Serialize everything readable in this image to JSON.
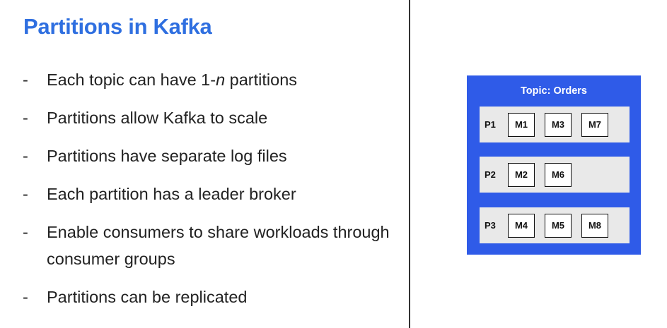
{
  "slide": {
    "title": "Partitions in Kafka",
    "bullets": [
      {
        "before": "Each topic can have 1-",
        "italic": "n",
        "after": " partitions"
      },
      {
        "text": "Partitions allow Kafka to scale"
      },
      {
        "text": "Partitions have separate log files"
      },
      {
        "text": "Each partition has a leader broker"
      },
      {
        "text": "Enable consumers to share workloads through consumer groups"
      },
      {
        "text": "Partitions can be replicated"
      }
    ],
    "bullet_marker": "-"
  },
  "diagram": {
    "topic_title": "Topic: Orders",
    "partitions": [
      {
        "label": "P1",
        "messages": [
          "M1",
          "M3",
          "M7"
        ]
      },
      {
        "label": "P2",
        "messages": [
          "M2",
          "M6"
        ]
      },
      {
        "label": "P3",
        "messages": [
          "M4",
          "M5",
          "M8"
        ]
      }
    ]
  },
  "colors": {
    "title": "#2f6fe0",
    "topic_box": "#2f5be8",
    "partition_row": "#e9e9e9"
  }
}
